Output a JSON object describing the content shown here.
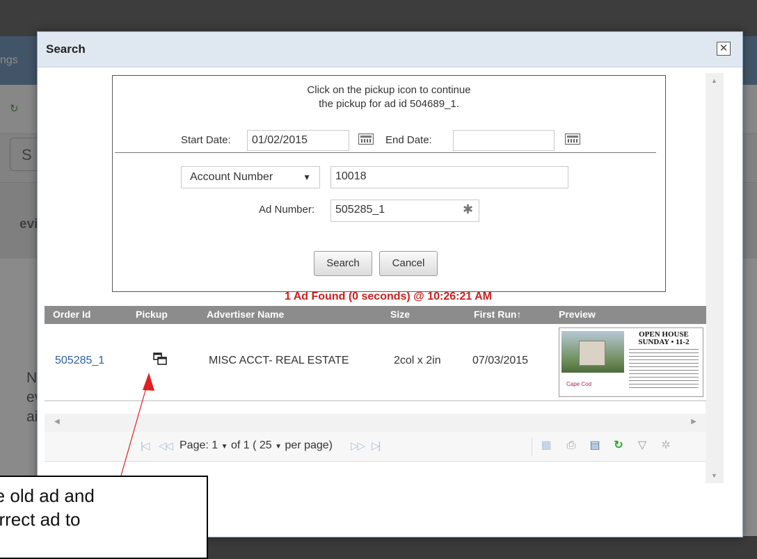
{
  "background": {
    "topbar_text": "ngs",
    "tab_text": "S",
    "section_text": "evi",
    "side_text": [
      "No",
      "evi",
      "aila"
    ]
  },
  "dialog": {
    "title": "Search",
    "close_glyph": "✕",
    "message": [
      "Click on the pickup icon to continue",
      "the pickup for ad id 504689_1."
    ],
    "start_date_label": "Start Date:",
    "start_date_value": "01/02/2015",
    "end_date_label": "End Date:",
    "end_date_value": "",
    "search_by_selected": "Account Number",
    "search_by_value": "10018",
    "ad_number_label": "Ad Number:",
    "ad_number_value": "505285_1",
    "search_button": "Search",
    "cancel_button": "Cancel",
    "found_text": "1 Ad Found (0 seconds) @ 10:26:21 AM"
  },
  "grid": {
    "columns": [
      "Order Id",
      "Pickup",
      "Advertiser Name",
      "Size",
      "First Run↑",
      "Preview"
    ],
    "rows": [
      {
        "order_id": "505285_1",
        "pickup_icon": "pickup-icon",
        "advertiser": "MISC ACCT- REAL ESTATE",
        "size": "2col x 2in",
        "first_run": "07/03/2015",
        "preview": {
          "title_line1": "OPEN HOUSE",
          "title_line2": "SUNDAY • 11-2",
          "logo": "Cape Cod"
        }
      }
    ]
  },
  "pager": {
    "page_label": "Page:",
    "page_value": "1",
    "of_text": "of 1 (",
    "per_page_value": "25",
    "per_page_text": "per page)"
  },
  "callout": {
    "lines": [
      "the old ad and",
      "correct ad to"
    ]
  },
  "colors": {
    "found_text": "#cc1f1f",
    "grid_header": "#8c8c8c",
    "link": "#2a60a8",
    "dialog_header": "#dfe7f1"
  }
}
